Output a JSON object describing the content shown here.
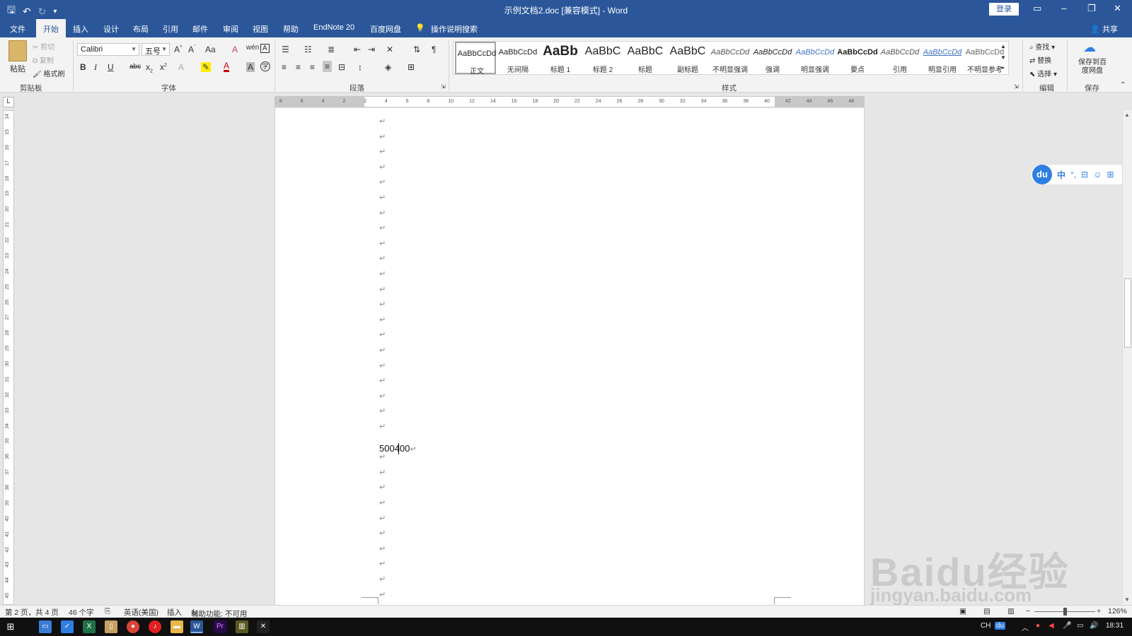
{
  "window": {
    "title": "示例文档2.doc [兼容模式]  -  Word",
    "login_label": "登录",
    "minimize_glyph": "–",
    "restore_glyph": "❐",
    "close_glyph": "✕",
    "ribbon_display_glyph": "▭"
  },
  "quick_access": {
    "save_glyph": "🖫",
    "undo_glyph": "↶",
    "redo_glyph": "↻",
    "customize_glyph": "▾"
  },
  "tabs": [
    "文件",
    "开始",
    "插入",
    "设计",
    "布局",
    "引用",
    "邮件",
    "审阅",
    "视图",
    "帮助",
    "EndNote 20",
    "百度网盘"
  ],
  "active_tab": "开始",
  "tell_me": "操作说明搜索",
  "share_label": "共享",
  "clipboard": {
    "paste": "粘贴",
    "cut": "剪切",
    "copy": "复制",
    "format_painter": "格式刷",
    "group_label": "剪贴板"
  },
  "font": {
    "name": "Calibri",
    "size": "五号",
    "group_label": "字体"
  },
  "paragraph": {
    "group_label": "段落"
  },
  "styles": {
    "group_label": "样式",
    "items": [
      {
        "sample": "AaBbCcDd",
        "name": "正文"
      },
      {
        "sample": "AaBbCcDd",
        "name": "无间隔"
      },
      {
        "sample": "AaBb",
        "name": "标题 1"
      },
      {
        "sample": "AaBbC",
        "name": "标题 2"
      },
      {
        "sample": "AaBbC",
        "name": "标题"
      },
      {
        "sample": "AaBbC",
        "name": "副标题"
      },
      {
        "sample": "AaBbCcDd",
        "name": "不明显强调"
      },
      {
        "sample": "AaBbCcDd",
        "name": "强调"
      },
      {
        "sample": "AaBbCcDd",
        "name": "明显强调"
      },
      {
        "sample": "AaBbCcDd",
        "name": "要点"
      },
      {
        "sample": "AaBbCcDd",
        "name": "引用"
      },
      {
        "sample": "AaBbCcDd",
        "name": "明显引用"
      },
      {
        "sample": "AaBbCcDd",
        "name": "不明显参考"
      }
    ]
  },
  "editing": {
    "find": "查找",
    "replace": "替换",
    "select": "选择",
    "group_label": "编辑"
  },
  "save_group": {
    "save_to_baidu": "保存到百度网盘",
    "group_label": "保存"
  },
  "ruler_corner": "L",
  "ruler_numbers": [
    "8",
    "6",
    "4",
    "2",
    "2",
    "4",
    "6",
    "8",
    "10",
    "12",
    "14",
    "16",
    "18",
    "20",
    "22",
    "24",
    "26",
    "28",
    "30",
    "32",
    "34",
    "36",
    "38",
    "40",
    "42",
    "44",
    "46",
    "48"
  ],
  "vruler_numbers": [
    "14",
    "15",
    "16",
    "17",
    "18",
    "19",
    "20",
    "21",
    "22",
    "23",
    "24",
    "25",
    "26",
    "27",
    "28",
    "29",
    "30",
    "31",
    "32",
    "33",
    "34",
    "35",
    "36",
    "37",
    "38",
    "39",
    "40",
    "41",
    "42",
    "43",
    "44",
    "45"
  ],
  "document": {
    "typed_text": "500400",
    "paragraph_mark": "↵"
  },
  "baidu_toolbar": {
    "logo": "du",
    "lang": "中"
  },
  "status": {
    "page": "第 2 页，共 4 页",
    "words": "46 个字",
    "language": "英语(美国)",
    "mode": "插入",
    "accessibility": "辅助功能: 不可用",
    "zoom": "126%"
  },
  "taskbar": {
    "ime": "CH",
    "time": "18:31"
  },
  "watermark": {
    "brand": "Baidu经验",
    "url": "jingyan.baidu.com"
  },
  "colors": {
    "word_blue": "#2b579a",
    "ribbon_bg": "#f3f3f3",
    "baidu_blue": "#2f7fe3"
  }
}
